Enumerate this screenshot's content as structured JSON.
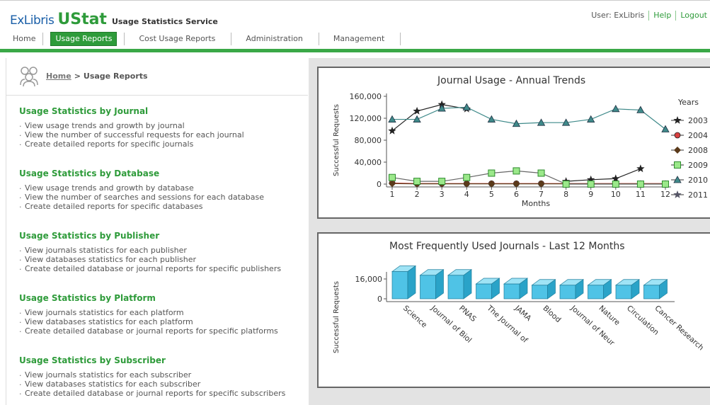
{
  "header": {
    "logo_exlibris": "ExLibris",
    "logo_ustat": "UStat",
    "logo_tagline": "Usage Statistics Service",
    "user_label": "User: ExLibris",
    "help_link": "Help",
    "logout_link": "Logout"
  },
  "nav": {
    "items": [
      "Home",
      "Usage Reports",
      "Cost Usage Reports",
      "Administration",
      "Management"
    ],
    "active": "Usage Reports"
  },
  "breadcrumb": {
    "home": "Home",
    "separator": ">",
    "current": "Usage Reports"
  },
  "sections": [
    {
      "title": "Usage Statistics by Journal",
      "items": [
        "View usage trends and growth by journal",
        "View the number of successful requests for each journal",
        "Create detailed reports for specific journals"
      ]
    },
    {
      "title": "Usage Statistics by Database",
      "items": [
        "View usage trends and growth by database",
        "View the number of searches and sessions for each database",
        "Create detailed reports for specific databases"
      ]
    },
    {
      "title": "Usage Statistics by Publisher",
      "items": [
        "View journals statistics for each publisher",
        "View databases statistics for each publisher",
        "Create detailed database or journal reports for specific publishers"
      ]
    },
    {
      "title": "Usage Statistics by Platform",
      "items": [
        "View journals statistics for each platform",
        "View databases statistics for each platform",
        "Create detailed database or journal reports for specific platforms"
      ]
    },
    {
      "title": "Usage Statistics by Subscriber",
      "items": [
        "View journals statistics for each subscriber",
        "View databases statistics for each subscriber",
        "Create detailed database or journal reports for specific subscribers"
      ]
    }
  ],
  "colors": {
    "brand_green": "#2e9b3a",
    "brand_blue": "#1a5fa8",
    "bar_color": "#4fc3e6"
  },
  "chart_data": [
    {
      "type": "line",
      "title": "Journal Usage - Annual Trends",
      "xlabel": "Months",
      "ylabel": "Successful Requests",
      "x": [
        1,
        2,
        3,
        4,
        5,
        6,
        7,
        8,
        9,
        10,
        11,
        12
      ],
      "ylim": [
        0,
        160000
      ],
      "yticks": [
        "0",
        "40,000",
        "80,000",
        "120,000",
        "160,000"
      ],
      "ytick_values": [
        0,
        40000,
        80000,
        120000,
        160000
      ],
      "legend_title": "Years",
      "legend_position": "right",
      "series": [
        {
          "name": "2003",
          "color": "#222222",
          "marker": "star",
          "values": [
            97000,
            133000,
            145000,
            137000,
            null,
            null,
            null,
            5000,
            8000,
            10000,
            28000,
            null
          ]
        },
        {
          "name": "2004",
          "color": "#d94040",
          "marker": "circle",
          "values": [
            2000,
            1000,
            1000,
            1000,
            1000,
            1000,
            1000,
            1000,
            1000,
            1000,
            1000,
            1000
          ]
        },
        {
          "name": "2008",
          "color": "#5a3a1a",
          "marker": "diamond",
          "values": [
            1000,
            500,
            500,
            500,
            500,
            500,
            500,
            500,
            500,
            500,
            500,
            500
          ]
        },
        {
          "name": "2009",
          "color": "#55cc44",
          "marker": "square",
          "values": [
            12000,
            5000,
            5000,
            12000,
            20000,
            24000,
            20000,
            0,
            0,
            0,
            0,
            0
          ]
        },
        {
          "name": "2010",
          "color": "#3f8a8a",
          "marker": "triangle",
          "values": [
            118000,
            118000,
            138000,
            140000,
            118000,
            110000,
            112000,
            112000,
            118000,
            137000,
            135000,
            100000
          ]
        },
        {
          "name": "2011",
          "color": "#555566",
          "marker": "star",
          "values": [
            null,
            null,
            null,
            null,
            null,
            null,
            null,
            null,
            null,
            null,
            null,
            null
          ]
        }
      ]
    },
    {
      "type": "bar",
      "title": "Most Frequently Used Journals - Last 12 Months",
      "ylabel": "Successful Requests",
      "categories": [
        "Science",
        "Journal of Biol",
        "PNAS",
        "The Journal of",
        "JAMA",
        "Blood",
        "Journal of Neur",
        "Nature",
        "Circulation",
        "Cancer Research"
      ],
      "values": [
        22000,
        19000,
        19000,
        12000,
        12000,
        11000,
        11000,
        11000,
        11000,
        11000
      ],
      "ylim": [
        0,
        16000
      ],
      "yticks": [
        "0",
        "16,000"
      ],
      "ytick_values": [
        0,
        16000
      ]
    }
  ]
}
